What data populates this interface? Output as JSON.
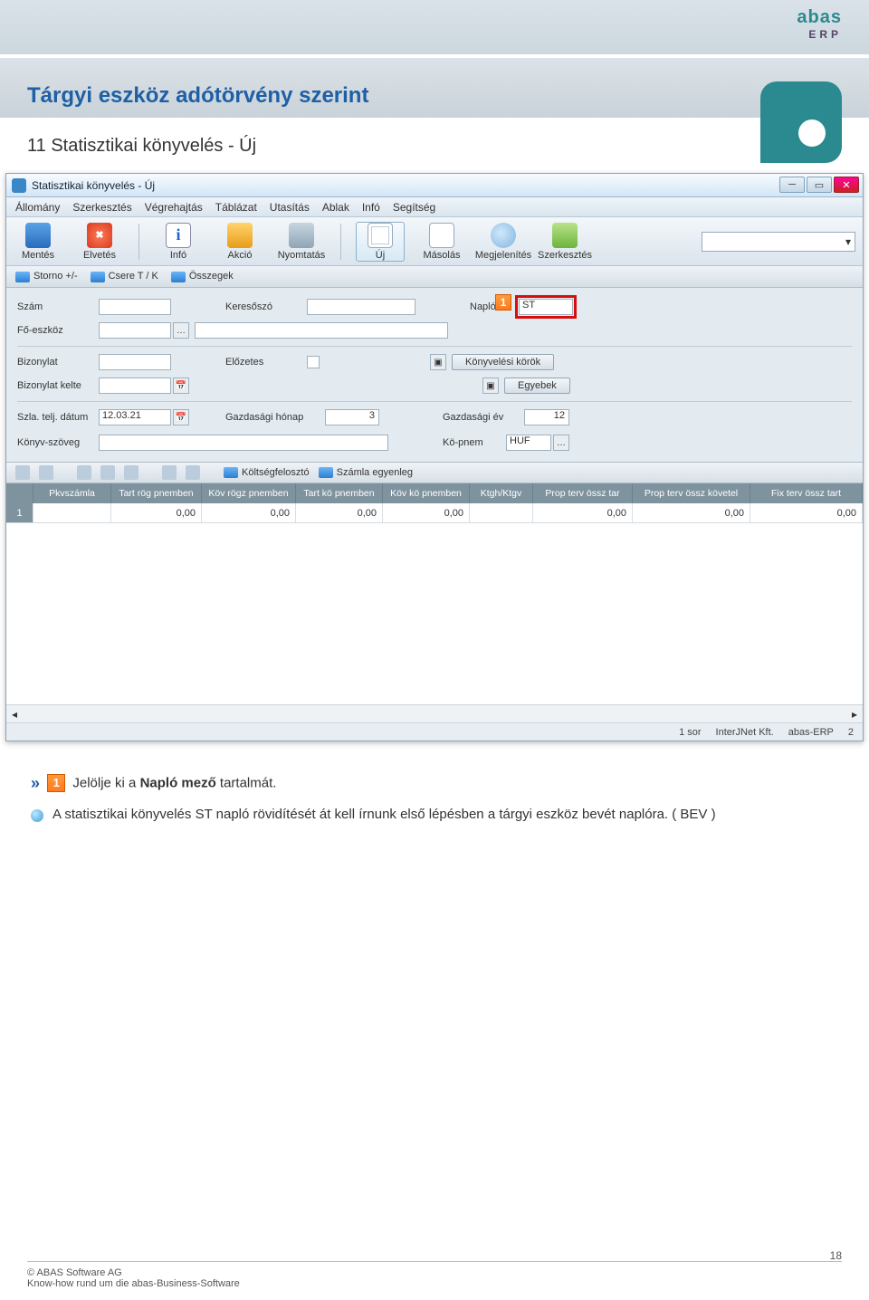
{
  "brand": {
    "name": "abas",
    "sub": "ERP"
  },
  "page_title": "Tárgyi eszköz adótörvény szerint",
  "section": "11 Statisztikai könyvelés - Új",
  "window": {
    "title": "Statisztikai könyvelés - Új",
    "menu": [
      "Állomány",
      "Szerkesztés",
      "Végrehajtás",
      "Táblázat",
      "Utasítás",
      "Ablak",
      "Infó",
      "Segítség"
    ],
    "toolbar": [
      {
        "id": "mentes",
        "label": "Mentés"
      },
      {
        "id": "elvetes",
        "label": "Elvetés"
      },
      {
        "id": "info",
        "label": "Infó"
      },
      {
        "id": "akcio",
        "label": "Akció"
      },
      {
        "id": "nyomtatas",
        "label": "Nyomtatás"
      },
      {
        "id": "uj",
        "label": "Új"
      },
      {
        "id": "masolas",
        "label": "Másolás"
      },
      {
        "id": "megjelenites",
        "label": "Megjelenítés"
      },
      {
        "id": "szerkesztes",
        "label": "Szerkesztés"
      }
    ],
    "subtoolbar": [
      "Storno +/-",
      "Csere  T / K",
      "Összegek"
    ],
    "fields": {
      "szam": {
        "label": "Szám",
        "value": ""
      },
      "keresoszo": {
        "label": "Keresőszó",
        "value": ""
      },
      "naplo": {
        "label": "Napló",
        "value": "ST"
      },
      "foeszkoz": {
        "label": "Fő-eszköz",
        "value": ""
      },
      "bizonylat": {
        "label": "Bizonylat",
        "value": ""
      },
      "elozetes": {
        "label": "Előzetes"
      },
      "konyvelesi_korok": {
        "label": "Könyvelési körök"
      },
      "bizonylat_kelte": {
        "label": "Bizonylat kelte",
        "value": ""
      },
      "egyebek": {
        "label": "Egyebek"
      },
      "szla_telj_datum": {
        "label": "Szla. telj. dátum",
        "value": "12.03.21"
      },
      "gazd_honap": {
        "label": "Gazdasági hónap",
        "value": "3"
      },
      "gazd_ev": {
        "label": "Gazdasági év",
        "value": "12"
      },
      "konyv_szoveg": {
        "label": "Könyv-szöveg",
        "value": ""
      },
      "ko_pnem": {
        "label": "Kö-pnem",
        "value": "HUF"
      }
    },
    "gridtoolbar": [
      "Költségfelosztó",
      "Számla egyenleg"
    ],
    "grid": {
      "columns": [
        "",
        "Pkvszámla",
        "Tart rög pnemben",
        "Köv rögz pnemben",
        "Tart kö pnemben",
        "Köv kö pnemben",
        "Ktgh/Ktgv",
        "Prop terv össz tar",
        "Prop terv össz követel",
        "Fix terv össz tart"
      ],
      "row": [
        "1",
        "",
        "0,00",
        "0,00",
        "0,00",
        "0,00",
        "",
        "0,00",
        "0,00",
        "0,00"
      ]
    },
    "status": {
      "rows": "1 sor",
      "company": "InterJNet Kft.",
      "app": "abas-ERP",
      "num": "2"
    }
  },
  "instructions": {
    "step_badge": "1",
    "step_text_pre": "Jelölje ki a ",
    "step_bold": "Napló",
    "step_text_mid": " mező",
    "step_text_post": " tartalmát.",
    "note": "A statisztikai könyvelés ST napló rövidítését át kell írnunk első lépésben a tárgyi eszköz bevét naplóra. ( BEV )"
  },
  "footer": {
    "copyright": "© ABAS Software AG",
    "tagline": "Know-how rund um die abas-Business-Software",
    "page_number": "18"
  }
}
